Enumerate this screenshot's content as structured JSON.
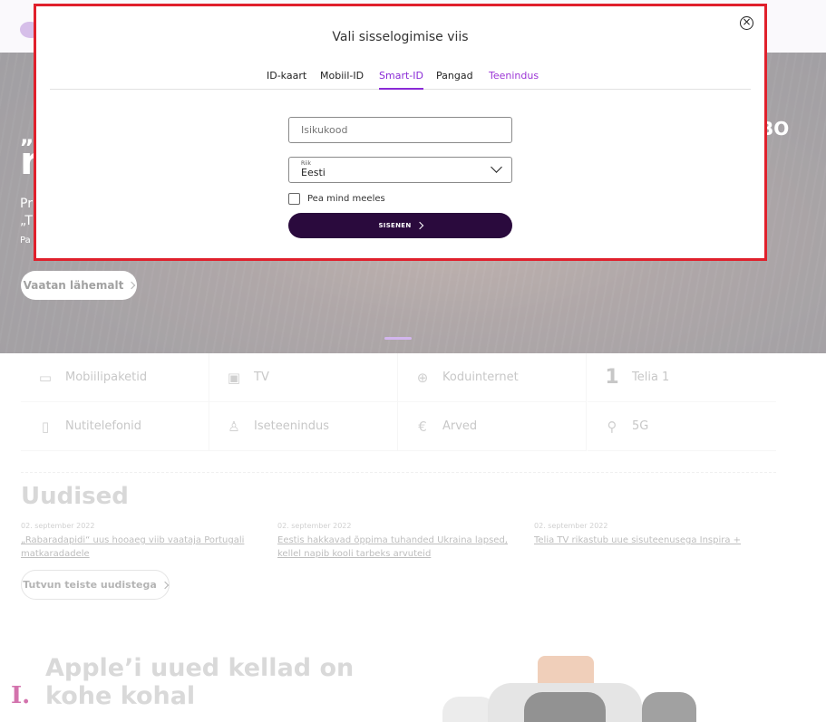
{
  "hero": {
    "quote_start": "„s",
    "big_start": "r",
    "line1_start": "Pr",
    "line2_start": "„T",
    "line3_start": "Pa",
    "logo_fragment": "BO",
    "cta_label": "Vaatan lähemalt"
  },
  "services": [
    {
      "label": "Mobiilipaketid",
      "icon": "phone-plan-icon",
      "glyph": "▭"
    },
    {
      "label": "TV",
      "icon": "tv-icon",
      "glyph": "▣"
    },
    {
      "label": "Koduinternet",
      "icon": "globe-icon",
      "glyph": "⊕"
    },
    {
      "label": "Telia 1",
      "icon": "telia-one-icon",
      "glyph": "1"
    },
    {
      "label": "Nutitelefonid",
      "icon": "smartphone-icon",
      "glyph": "▯"
    },
    {
      "label": "Iseteenindus",
      "icon": "user-lock-icon",
      "glyph": "♙"
    },
    {
      "label": "Arved",
      "icon": "invoice-icon",
      "glyph": "€"
    },
    {
      "label": "5G",
      "icon": "rocket-icon",
      "glyph": "⚲"
    }
  ],
  "news": {
    "title": "Uudised",
    "items": [
      {
        "date": "02. september 2022",
        "headline": "„Rabaradapidi“ uus hooaeg viib vaataja Portugali matkaradadele"
      },
      {
        "date": "02. september 2022",
        "headline": "Eestis hakkavad õppima tuhanded Ukraina lapsed, kellel napib kooli tarbeks arvuteid"
      },
      {
        "date": "02. september 2022",
        "headline": "Telia TV rikastub uue sisuteenusega Inspira +"
      }
    ],
    "more_label": "Tutvun teiste uudistega"
  },
  "promo": {
    "title": "Apple’i uued kellad on kohe kohal"
  },
  "corner_mark": "I.",
  "modal": {
    "title": "Vali sisselogimise viis",
    "close_glyph": "×",
    "tabs": [
      {
        "label": "ID-kaart"
      },
      {
        "label": "Mobiil-ID"
      },
      {
        "label": "Smart-ID"
      },
      {
        "label": "Pangad"
      },
      {
        "label": "Teenindus"
      }
    ],
    "active_tab": "Smart-ID",
    "id_code_placeholder": "Isikukood",
    "country_label": "Riik",
    "country_value": "Eesti",
    "remember_label": "Pea mind meeles",
    "remember_checked": false,
    "submit_label": "SISENEN"
  },
  "colors": {
    "accent": "#8a2bd6",
    "button_dark": "#2a0a3d",
    "highlight_border": "#e0202c"
  }
}
